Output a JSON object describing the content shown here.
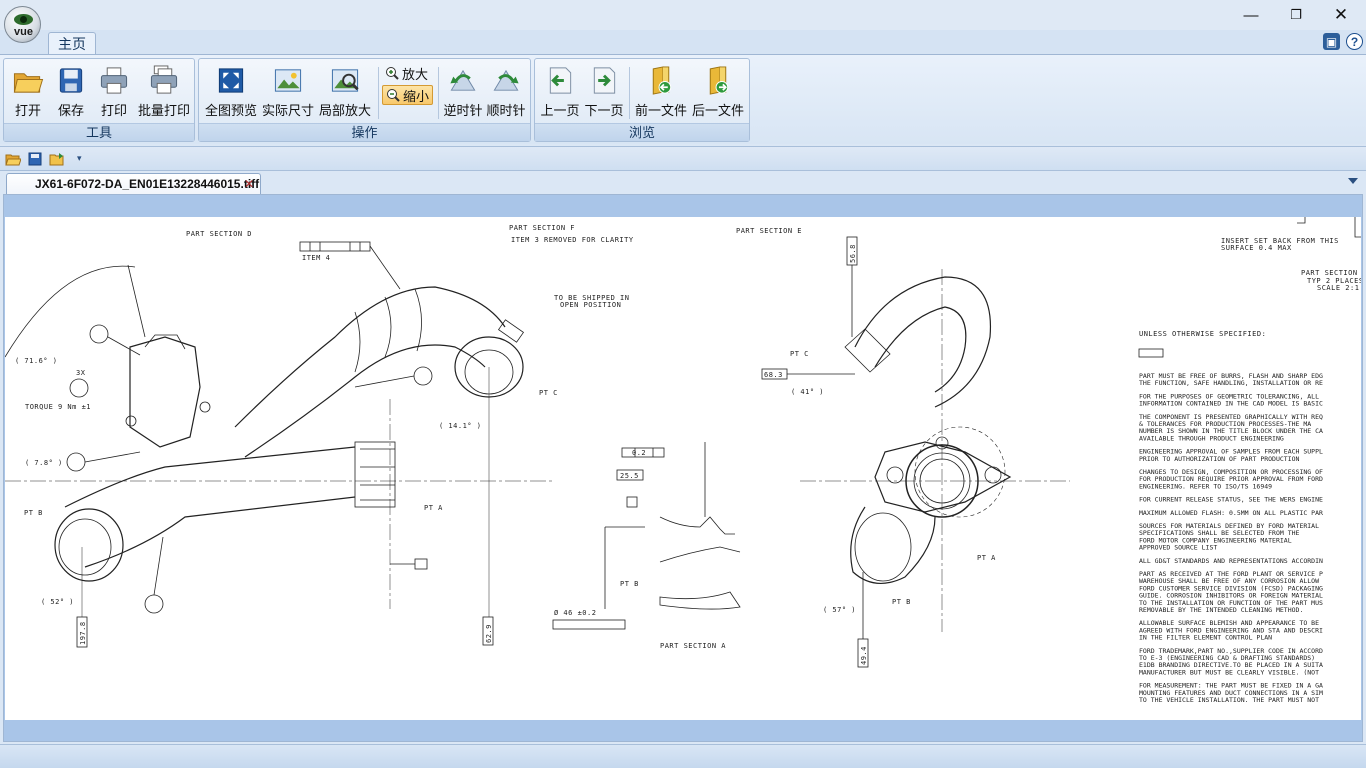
{
  "app": {
    "logo_text": "vue"
  },
  "ribbon": {
    "tab_home": "主页",
    "groups": {
      "tools": {
        "label": "工具",
        "open": "打开",
        "save": "保存",
        "print": "打印",
        "batch_print": "批量打印"
      },
      "operation": {
        "label": "操作",
        "fit_view": "全图预览",
        "actual_size": "实际尺寸",
        "zoom_area": "局部放大",
        "zoom_in": "放大",
        "zoom_out": "缩小",
        "rotate_ccw": "逆时针",
        "rotate_cw": "顺时针"
      },
      "browse": {
        "label": "浏览",
        "prev_page": "上一页",
        "next_page": "下一页",
        "prev_file": "前一文件",
        "next_file": "后一文件"
      }
    }
  },
  "document": {
    "tab_title": "JX61-6F072-DA_EN01E13228446015.tiff"
  },
  "drawing": {
    "section_d": "PART SECTION  D",
    "section_f": "PART SECTION  F",
    "item3_removed": "ITEM 3 REMOVED FOR CLARITY",
    "section_e": "PART SECTION  E",
    "item4": "ITEM 4",
    "ship_open_1": "TO BE SHIPPED IN",
    "ship_open_2": "OPEN POSITION",
    "ang_71": "( 71.6° )",
    "count_3x": "3X",
    "torque": "TORQUE 9 Nm ±1",
    "ang_78": "( 7.8° )",
    "ang_52": "( 52° )",
    "ang_141": "( 14.1° )",
    "ang_41": "( 41° )",
    "ang_57": "( 57° )",
    "pt_b": "PT B",
    "pt_c": "PT C",
    "pt_a": "PT A",
    "dim_1978": "197.8",
    "dim_629": "62.9",
    "dim_568": "56.8",
    "dim_683": "68.3",
    "dim_494": "49.4",
    "tol_02": "0.2",
    "dim_255": "25.5",
    "dim_diam": "Ø 46 ±0.2",
    "section_a": "PART SECTION  A",
    "insert_1": "INSERT SET BACK FROM THIS",
    "insert_2": "SURFACE 0.4 MAX",
    "section_typ_1": "PART SECTION",
    "section_typ_2": "TYP 2 PLACES",
    "section_typ_3": "SCALE 2:1",
    "notes_title": "UNLESS OTHERWISE SPECIFIED:",
    "notes": [
      "PART MUST BE FREE OF BURRS, FLASH AND SHARP EDG",
      "THE FUNCTION, SAFE HANDLING, INSTALLATION OR RE",
      "FOR THE PURPOSES OF GEOMETRIC TOLERANCING, ALL",
      "INFORMATION CONTAINED IN THE CAD MODEL IS BASIC",
      "THE COMPONENT IS PRESENTED GRAPHICALLY WITH REQ",
      "& TOLERANCES FOR PRODUCTION PROCESSES-THE MA",
      "NUMBER IS SHOWN IN THE TITLE BLOCK UNDER THE CA",
      "AVAILABLE THROUGH PRODUCT ENGINEERING",
      "ENGINEERING APPROVAL OF SAMPLES FROM EACH SUPPL",
      "PRIOR TO AUTHORIZATION OF PART PRODUCTION",
      "CHANGES TO DESIGN, COMPOSITION OR PROCESSING OF",
      "FOR PRODUCTION REQUIRE PRIOR APPROVAL FROM FORD",
      "ENGINEERING. REFER TO ISO/TS 16949",
      "FOR CURRENT RELEASE STATUS, SEE THE WERS ENGINE",
      "MAXIMUM ALLOWED FLASH: 0.5MM ON ALL PLASTIC PAR",
      "SOURCES FOR MATERIALS DEFINED BY FORD MATERIAL",
      "SPECIFICATIONS SHALL BE SELECTED FROM THE",
      "FORD MOTOR COMPANY ENGINEERING MATERIAL",
      "APPROVED SOURCE LIST",
      "ALL GD&T STANDARDS AND REPRESENTATIONS ACCORDIN",
      "PART AS RECEIVED AT THE FORD PLANT OR SERVICE P",
      "WAREHOUSE SHALL BE FREE OF ANY CORROSION ALLOW",
      "FORD CUSTOMER SERVICE DIVISION (FCSD) PACKAGING",
      "GUIDE. CORROSION INHIBITORS OR FOREIGN MATERIAL",
      "TO THE INSTALLATION OR FUNCTION OF THE PART MUS",
      "REMOVABLE BY THE INTENDED CLEANING METHOD.",
      "ALLOWABLE SURFACE BLEMISH AND APPEARANCE TO BE",
      "AGREED WITH FORD ENGINEERING AND STA AND DESCRI",
      "IN THE FILTER ELEMENT CONTROL PLAN",
      "FORD TRADEMARK,PART NO.,SUPPLIER CODE IN ACCORD",
      "TO E-3 (ENGINEERING CAD & DRAFTING STANDARDS)",
      "E1DB BRANDING DIRECTIVE.TO BE PLACED IN A SUITA",
      "MANUFACTURER BUT MUST BE CLEARLY VISIBLE. (NOT",
      "FOR MEASUREMENT: THE PART MUST BE FIXED IN A GA",
      "MOUNTING FEATURES AND DUCT CONNECTIONS IN A SIM",
      "TO THE VEHICLE INSTALLATION. THE PART MUST NOT"
    ]
  }
}
